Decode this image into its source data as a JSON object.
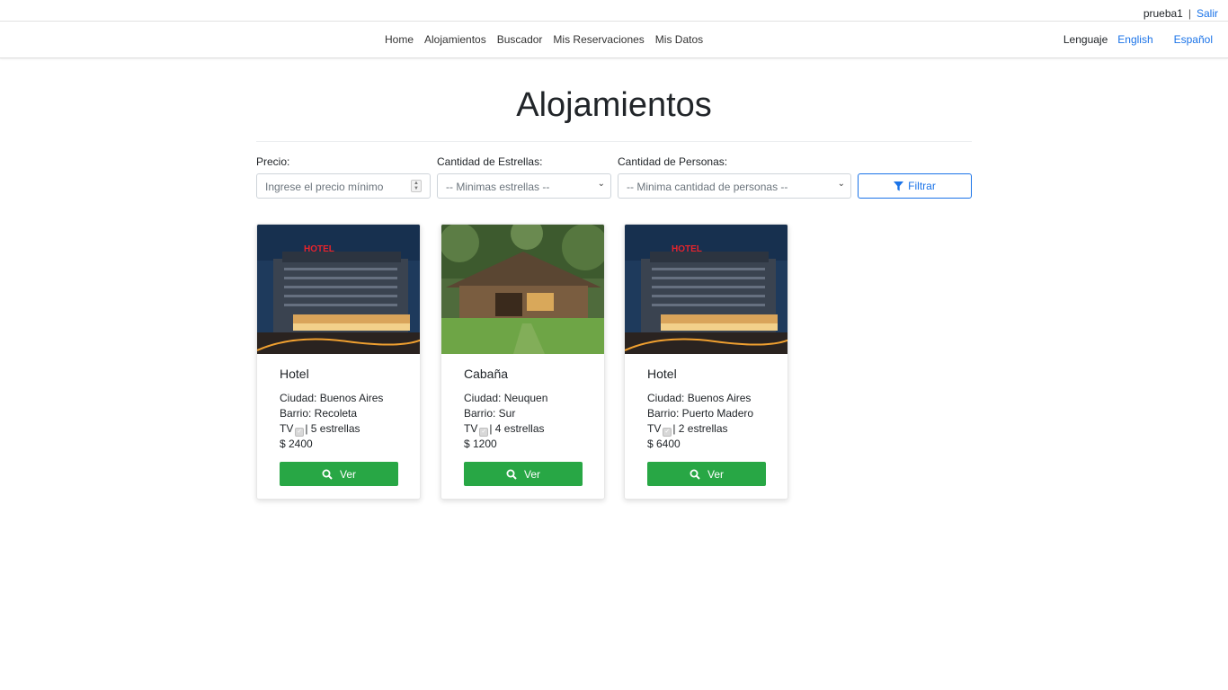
{
  "topbar": {
    "username": "prueba1",
    "separator": "|",
    "logout": "Salir"
  },
  "nav": {
    "links": [
      "Home",
      "Alojamientos",
      "Buscador",
      "Mis Reservaciones",
      "Mis Datos"
    ]
  },
  "language": {
    "label": "Lenguaje",
    "english": "English",
    "spanish": "Español"
  },
  "page": {
    "title": "Alojamientos"
  },
  "filters": {
    "price_label": "Precio:",
    "price_placeholder": "Ingrese el precio mínimo",
    "stars_label": "Cantidad de Estrellas:",
    "stars_selected": "-- Minimas estrellas --",
    "people_label": "Cantidad de Personas:",
    "people_selected": "-- Minima cantidad de personas --",
    "filter_button": "Filtrar"
  },
  "cards": [
    {
      "title": "Hotel",
      "city": "Ciudad: Buenos Aires",
      "barrio": "Barrio: Recoleta",
      "tv": "TV",
      "stars": "| 5 estrellas",
      "price": "$ 2400",
      "button": "Ver",
      "image": "hotel-night-photo"
    },
    {
      "title": "Cabaña",
      "city": "Ciudad: Neuquen",
      "barrio": "Barrio: Sur",
      "tv": "TV",
      "stars": "| 4 estrellas",
      "price": "$ 1200",
      "button": "Ver",
      "image": "wooden-cabin-photo"
    },
    {
      "title": "Hotel",
      "city": "Ciudad: Buenos Aires",
      "barrio": "Barrio: Puerto Madero",
      "tv": "TV",
      "stars": "| 2 estrellas",
      "price": "$ 6400",
      "button": "Ver",
      "image": "hotel-night-photo"
    }
  ],
  "images": {
    "hotel_sign": "HOTEL"
  },
  "colors": {
    "link": "#1a73e8",
    "button_green": "#28a745"
  }
}
